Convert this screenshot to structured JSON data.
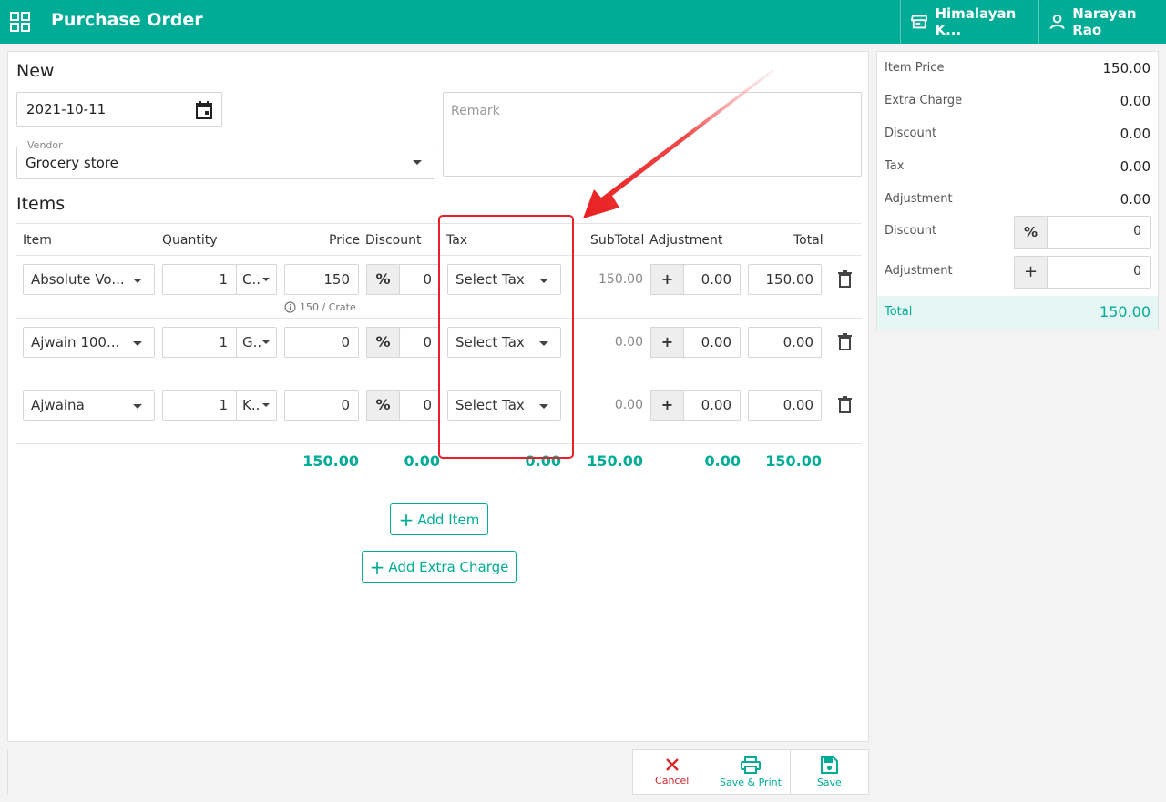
{
  "header": {
    "title": "Purchase Order",
    "store": "Himalayan K...",
    "user": "Narayan Rao"
  },
  "form": {
    "heading": "New",
    "date": "2021-10-11",
    "vendor_label": "Vendor",
    "vendor_value": "Grocery store",
    "remark_placeholder": "Remark"
  },
  "items": {
    "heading": "Items",
    "columns": [
      "Item",
      "Quantity",
      "Price",
      "Discount",
      "Tax",
      "SubTotal",
      "Adjustment",
      "Total"
    ],
    "rows": [
      {
        "item": "Absolute Vo...",
        "qty": "1",
        "unit": "C..",
        "price": "150",
        "discount_type": "%",
        "discount": "0",
        "tax": "Select Tax",
        "subtotal": "150.00",
        "adj_sign": "+",
        "adjustment": "0.00",
        "total": "150.00",
        "hint": "150 / Crate"
      },
      {
        "item": "Ajwain 100...",
        "qty": "1",
        "unit": "G..",
        "price": "0",
        "discount_type": "%",
        "discount": "0",
        "tax": "Select Tax",
        "subtotal": "0.00",
        "adj_sign": "+",
        "adjustment": "0.00",
        "total": "0.00"
      },
      {
        "item": "Ajwaina",
        "qty": "1",
        "unit": "K..",
        "price": "0",
        "discount_type": "%",
        "discount": "0",
        "tax": "Select Tax",
        "subtotal": "0.00",
        "adj_sign": "+",
        "adjustment": "0.00",
        "total": "0.00"
      }
    ],
    "footer": {
      "price": "150.00",
      "discount": "0.00",
      "tax": "0.00",
      "subtotal": "150.00",
      "adjustment": "0.00",
      "total": "150.00"
    },
    "add_item": "Add Item",
    "add_extra_charge": "Add Extra Charge"
  },
  "summary": {
    "rows": [
      {
        "label": "Item Price",
        "value": "150.00"
      },
      {
        "label": "Extra Charge",
        "value": "0.00"
      },
      {
        "label": "Discount",
        "value": "0.00"
      },
      {
        "label": "Tax",
        "value": "0.00"
      },
      {
        "label": "Adjustment",
        "value": "0.00"
      }
    ],
    "discount_label": "Discount",
    "discount_sign": "%",
    "discount_value": "0",
    "adjustment_label": "Adjustment",
    "adjustment_sign": "+",
    "adjustment_value": "0",
    "total_label": "Total",
    "total_value": "150.00"
  },
  "actions": {
    "cancel": "Cancel",
    "save_print": "Save & Print",
    "save": "Save"
  },
  "colors": {
    "brand": "#00ac96",
    "cancel": "#d9262c",
    "annotation": "#e8202a"
  },
  "icons": [
    "apps-grid-icon",
    "store-icon",
    "user-icon",
    "calendar-icon",
    "trash-icon",
    "info-icon",
    "plus-icon",
    "close-icon",
    "printer-icon",
    "save-icon"
  ]
}
